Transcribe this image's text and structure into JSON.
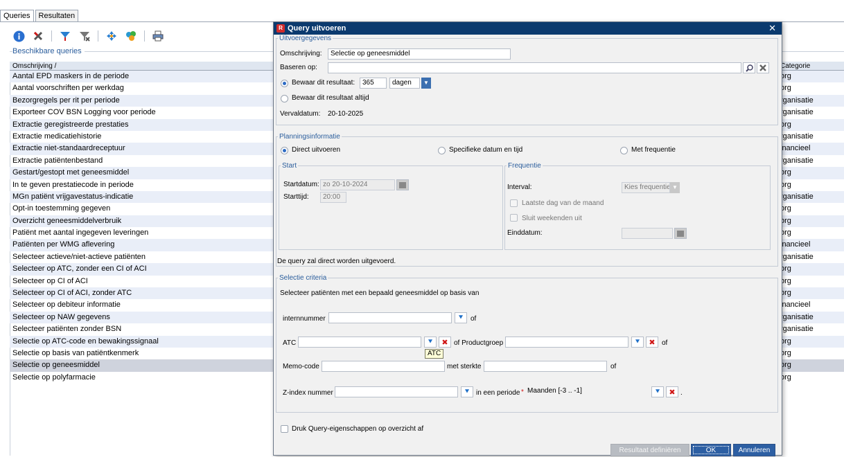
{
  "tabs": [
    "Queries",
    "Resultaten"
  ],
  "toolbar": {
    "icons": [
      "info-icon",
      "delete-icon",
      "filter-icon",
      "filter-remove-icon",
      "move-icon",
      "users-icon",
      "print-icon"
    ]
  },
  "group_title": "Beschikbare queries",
  "table": {
    "col_omschrijving": "Omschrijving /",
    "col_categorie": "Categorie",
    "rows": [
      {
        "name": "Aantal EPD maskers in de periode",
        "cat": "org"
      },
      {
        "name": "Aantal voorschriften per werkdag",
        "cat": "org"
      },
      {
        "name": "Bezorgregels per rit per periode",
        "cat": "rganisatie"
      },
      {
        "name": "Exporteer COV BSN Logging voor periode",
        "cat": "rganisatie"
      },
      {
        "name": "Extractie geregistreerde prestaties",
        "cat": "org"
      },
      {
        "name": "Extractie medicatiehistorie",
        "cat": "rganisatie"
      },
      {
        "name": "Extractie niet-standaardreceptuur",
        "cat": "inancieel"
      },
      {
        "name": "Extractie patiëntenbestand",
        "cat": "rganisatie"
      },
      {
        "name": "Gestart/gestopt met geneesmiddel",
        "cat": "org"
      },
      {
        "name": "In te geven prestatiecode in periode",
        "cat": "org"
      },
      {
        "name": "MGn patiënt vrijgavestatus-indicatie",
        "cat": "rganisatie"
      },
      {
        "name": "Opt-in toestemming gegeven",
        "cat": "org"
      },
      {
        "name": "Overzicht geneesmiddelverbruik",
        "cat": "org"
      },
      {
        "name": "Patiënt met aantal ingegeven leveringen",
        "cat": "org"
      },
      {
        "name": "Patiënten per WMG aflevering",
        "cat": "inancieel"
      },
      {
        "name": "Selecteer actieve/niet-actieve patiënten",
        "cat": "rganisatie"
      },
      {
        "name": "Selecteer op ATC, zonder een CI of ACI",
        "cat": "org"
      },
      {
        "name": "Selecteer op CI of ACI",
        "cat": "org"
      },
      {
        "name": "Selecteer op CI of ACI, zonder ATC",
        "cat": "org"
      },
      {
        "name": "Selecteer op debiteur informatie",
        "cat": "inancieel"
      },
      {
        "name": "Selecteer op NAW gegevens",
        "cat": "rganisatie"
      },
      {
        "name": "Selecteer patiënten zonder BSN",
        "cat": "rganisatie"
      },
      {
        "name": "Selectie op ATC-code en bewakingssignaal",
        "cat": "org"
      },
      {
        "name": "Selectie op basis van patiëntkenmerk",
        "cat": "org"
      },
      {
        "name": "Selectie op geneesmiddel",
        "cat": "org"
      },
      {
        "name": "Selectie op polyfarmacie",
        "cat": "org"
      }
    ]
  },
  "dialog": {
    "title": "Query uitvoeren",
    "close": "✕",
    "uitvoer": {
      "legend": "Uitvoergegevens",
      "omschrijving_label": "Omschrijving:",
      "omschrijving_value": "Selectie op geneesmiddel",
      "baseren_label": "Baseren op:",
      "baseren_value": "",
      "bewaar_label": "Bewaar dit resultaat:",
      "bewaar_value": "365",
      "bewaar_unit": "dagen",
      "altijd_label": "Bewaar dit resultaat altijd",
      "verval_label": "Vervaldatum:",
      "verval_value": "20-10-2025"
    },
    "planning": {
      "legend": "Planningsinformatie",
      "direct": "Direct uitvoeren",
      "specifiek": "Specifieke datum en tijd",
      "frequentie_opt": "Met frequentie",
      "start_legend": "Start",
      "startdatum_label": "Startdatum:",
      "startdatum_value": "zo 20-10-2024",
      "starttijd_label": "Starttijd:",
      "starttijd_value": "20:00",
      "freq_legend": "Frequentie",
      "interval_label": "Interval:",
      "interval_value": "Kies frequentie",
      "laatste_dag": "Laatste dag van de maand",
      "sluit_weekenden": "Sluit weekenden uit",
      "einddatum_label": "Einddatum:",
      "info": "De query zal direct worden uitgevoerd."
    },
    "selectie": {
      "legend": "Selectie criteria",
      "intro": "Selecteer patiënten met een bepaald geneesmiddel op basis van",
      "internnummer": "internnummer",
      "of": "of",
      "atc": "ATC",
      "of_productgroep": "of Productgroep",
      "tooltip": "ATC",
      "memo": "Memo-code",
      "met_sterkte": "met sterkte",
      "zindex": "Z-index nummer",
      "in_een_periode": "in een periode",
      "periode_value": "Maanden [-3 .. -1]",
      "dot": "."
    },
    "druk": "Druk Query-eigenschappen op overzicht af",
    "buttons": {
      "resultaat": "Resultaat definiëren",
      "ok": "OK",
      "annuleren": "Annuleren"
    }
  }
}
